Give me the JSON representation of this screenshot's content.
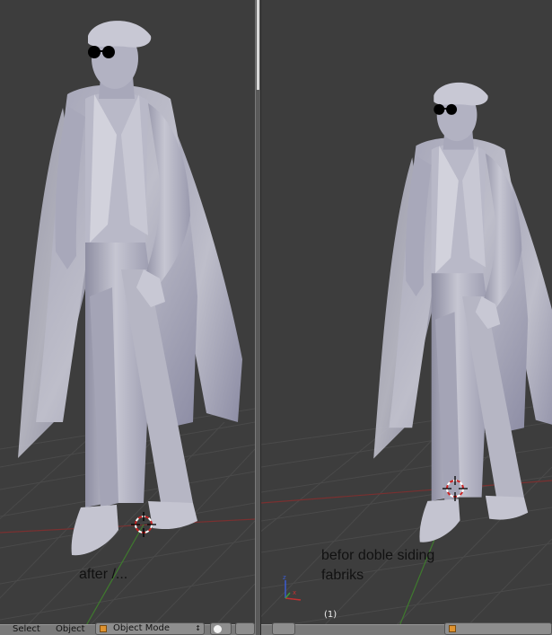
{
  "viewports": {
    "left": {
      "caption": "after /...",
      "header": {
        "select_label": "Select",
        "object_label": "Object",
        "mode_label": "Object Mode",
        "mode_arrows": "↕"
      }
    },
    "right": {
      "caption_line1": "befor doble siding",
      "caption_line2": "fabriks",
      "frame_label": "(1)"
    }
  },
  "icons": {
    "object_mode": "cube-icon",
    "viewport_shading": "sphere-icon",
    "axis_gizmo": "axis-gizmo-icon",
    "cursor_3d": "3d-cursor-icon"
  },
  "colors": {
    "viewport_bg": "#3d3d3d",
    "grid_line": "#4a4a4a",
    "x_axis": "#7a3030",
    "y_axis": "#3f7a2e",
    "model": "#b3b3c4",
    "header_bg": "#7a7a7a",
    "caption_text": "#111111"
  }
}
